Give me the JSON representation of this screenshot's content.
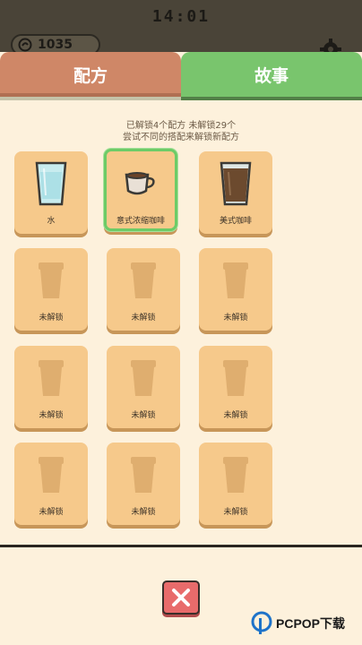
{
  "status_bar": {
    "time": "14:01"
  },
  "top_bar": {
    "coins": "1035"
  },
  "tabs": [
    {
      "label": "配方",
      "active": false
    },
    {
      "label": "故事",
      "active": true
    }
  ],
  "status": {
    "unlocked_line": "已解锁4个配方 未解锁29个",
    "hint_line": "尝试不同的搭配来解锁新配方"
  },
  "recipes": [
    {
      "label": "水",
      "icon": "water-glass-icon",
      "selected": false
    },
    {
      "label": "意式浓缩咖啡",
      "icon": "espresso-cup-icon",
      "selected": true
    },
    {
      "label": "美式咖啡",
      "icon": "americano-glass-icon",
      "selected": false
    },
    {
      "label": "未解锁",
      "icon": "locked-cup-icon"
    },
    {
      "label": "未解锁",
      "icon": "locked-cup-icon"
    },
    {
      "label": "未解锁",
      "icon": "locked-cup-icon"
    },
    {
      "label": "未解锁",
      "icon": "locked-cup-icon"
    },
    {
      "label": "未解锁",
      "icon": "locked-cup-icon"
    },
    {
      "label": "未解锁",
      "icon": "locked-cup-icon"
    },
    {
      "label": "未解锁",
      "icon": "locked-cup-icon"
    },
    {
      "label": "未解锁",
      "icon": "locked-cup-icon"
    },
    {
      "label": "未解锁",
      "icon": "locked-cup-icon"
    }
  ],
  "watermark": {
    "text": "PCPOP下载"
  },
  "colors": {
    "card": "#f6c98b",
    "selected_border": "#6dcb67",
    "recipe_tab": "#cf8767",
    "story_tab": "#79c56d",
    "close_button": "#e86b6b"
  }
}
